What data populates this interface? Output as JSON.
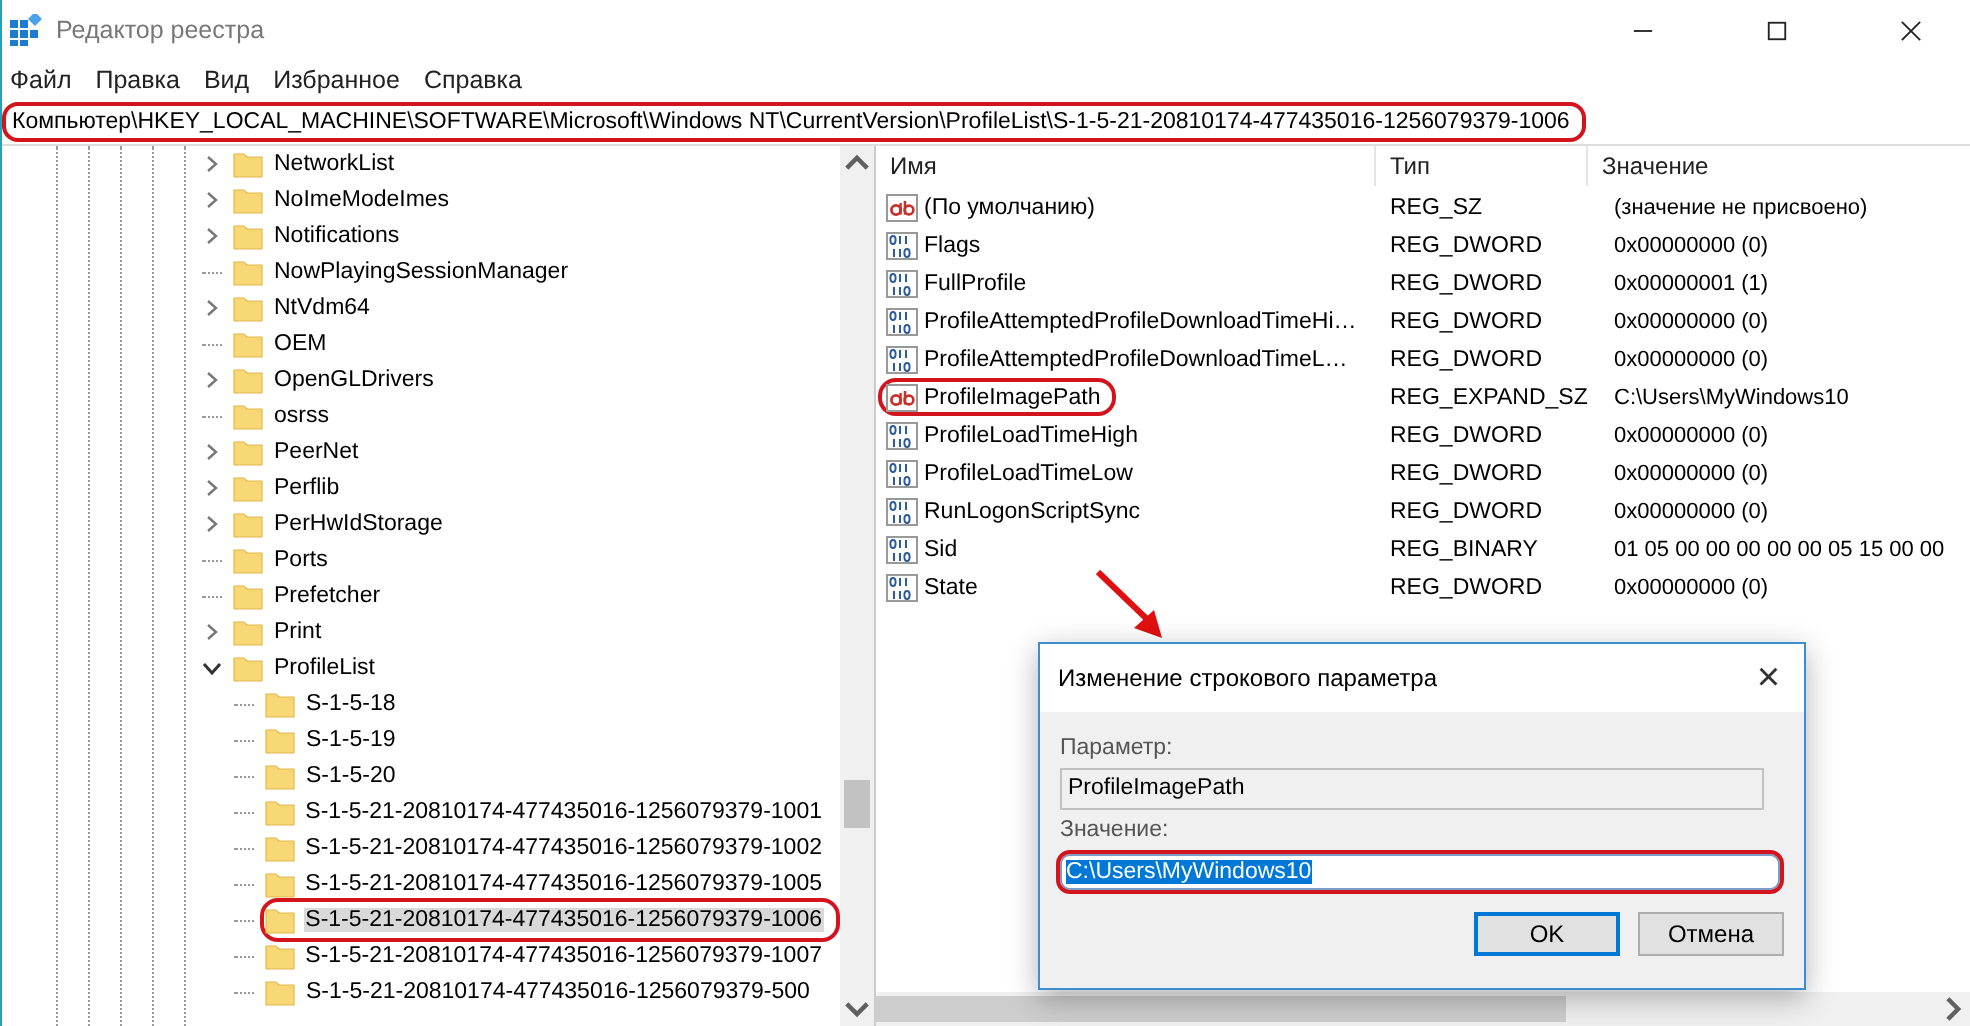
{
  "window": {
    "title": "Редактор реестра"
  },
  "menu": [
    "Файл",
    "Правка",
    "Вид",
    "Избранное",
    "Справка"
  ],
  "address_bar": {
    "value": "Компьютер\\HKEY_LOCAL_MACHINE\\SOFTWARE\\Microsoft\\Windows NT\\CurrentVersion\\ProfileList\\S-1-5-21-20810174-477435016-1256079379-1006",
    "highlighted": true
  },
  "tree": [
    {
      "label": "NetworkList",
      "expanded": false,
      "selected": false,
      "highlighted": false
    },
    {
      "label": "NoImeModeImes",
      "expanded": false,
      "selected": false,
      "highlighted": false
    },
    {
      "label": "Notifications",
      "expanded": false,
      "selected": false,
      "highlighted": false
    },
    {
      "label": "NowPlayingSessionManager",
      "selected": false,
      "highlighted": false
    },
    {
      "label": "NtVdm64",
      "expanded": false,
      "selected": false,
      "highlighted": false
    },
    {
      "label": "OEM",
      "selected": false,
      "highlighted": false
    },
    {
      "label": "OpenGLDrivers",
      "expanded": false,
      "selected": false,
      "highlighted": false
    },
    {
      "label": "osrss",
      "selected": false,
      "highlighted": false
    },
    {
      "label": "PeerNet",
      "expanded": false,
      "selected": false,
      "highlighted": false
    },
    {
      "label": "Perflib",
      "expanded": false,
      "selected": false,
      "highlighted": false
    },
    {
      "label": "PerHwIdStorage",
      "expanded": false,
      "selected": false,
      "highlighted": false
    },
    {
      "label": "Ports",
      "selected": false,
      "highlighted": false
    },
    {
      "label": "Prefetcher",
      "selected": false,
      "highlighted": false
    },
    {
      "label": "Print",
      "expanded": false,
      "selected": false,
      "highlighted": false
    },
    {
      "label": "ProfileList",
      "expanded": true,
      "selected": false,
      "highlighted": false,
      "children": [
        {
          "label": "S-1-5-18",
          "selected": false,
          "highlighted": false
        },
        {
          "label": "S-1-5-19",
          "selected": false,
          "highlighted": false
        },
        {
          "label": "S-1-5-20",
          "selected": false,
          "highlighted": false
        },
        {
          "label": "S-1-5-21-20810174-477435016-1256079379-1001",
          "selected": false,
          "highlighted": false
        },
        {
          "label": "S-1-5-21-20810174-477435016-1256079379-1002",
          "selected": false,
          "highlighted": false
        },
        {
          "label": "S-1-5-21-20810174-477435016-1256079379-1005",
          "selected": false,
          "highlighted": false
        },
        {
          "label": "S-1-5-21-20810174-477435016-1256079379-1006",
          "selected": true,
          "highlighted": true
        },
        {
          "label": "S-1-5-21-20810174-477435016-1256079379-1007",
          "selected": false,
          "highlighted": false
        },
        {
          "label": "S-1-5-21-20810174-477435016-1256079379-500",
          "selected": false,
          "highlighted": false
        }
      ]
    }
  ],
  "values": {
    "columns": [
      "Имя",
      "Тип",
      "Значение"
    ],
    "rows": [
      {
        "kind": "string",
        "name": "(По умолчанию)",
        "type": "REG_SZ",
        "data": "(значение не присвоено)",
        "highlighted": false
      },
      {
        "kind": "binary",
        "name": "Flags",
        "type": "REG_DWORD",
        "data": "0x00000000 (0)",
        "highlighted": false
      },
      {
        "kind": "binary",
        "name": "FullProfile",
        "type": "REG_DWORD",
        "data": "0x00000001 (1)",
        "highlighted": false
      },
      {
        "kind": "binary",
        "name": "ProfileAttemptedProfileDownloadTimeHi…",
        "type": "REG_DWORD",
        "data": "0x00000000 (0)",
        "highlighted": false
      },
      {
        "kind": "binary",
        "name": "ProfileAttemptedProfileDownloadTimeL…",
        "type": "REG_DWORD",
        "data": "0x00000000 (0)",
        "highlighted": false
      },
      {
        "kind": "string",
        "name": "ProfileImagePath",
        "type": "REG_EXPAND_SZ",
        "data": "C:\\Users\\MyWindows10",
        "highlighted": true
      },
      {
        "kind": "binary",
        "name": "ProfileLoadTimeHigh",
        "type": "REG_DWORD",
        "data": "0x00000000 (0)",
        "highlighted": false
      },
      {
        "kind": "binary",
        "name": "ProfileLoadTimeLow",
        "type": "REG_DWORD",
        "data": "0x00000000 (0)",
        "highlighted": false
      },
      {
        "kind": "binary",
        "name": "RunLogonScriptSync",
        "type": "REG_DWORD",
        "data": "0x00000000 (0)",
        "highlighted": false
      },
      {
        "kind": "binary",
        "name": "Sid",
        "type": "REG_BINARY",
        "data": "01 05 00 00 00 00 00 05 15 00 00",
        "highlighted": false
      },
      {
        "kind": "binary",
        "name": "State",
        "type": "REG_DWORD",
        "data": "0x00000000 (0)",
        "highlighted": false
      }
    ]
  },
  "dialog": {
    "title": "Изменение строкового параметра",
    "close": "×",
    "parameter_label": "Параметр:",
    "parameter_value": "ProfileImagePath",
    "value_label": "Значение:",
    "value": "C:\\Users\\MyWindows10",
    "value_selected": true,
    "value_highlighted": true,
    "buttons": [
      {
        "label": "OK",
        "default": true
      },
      {
        "label": "Отмена",
        "default": false
      }
    ]
  }
}
